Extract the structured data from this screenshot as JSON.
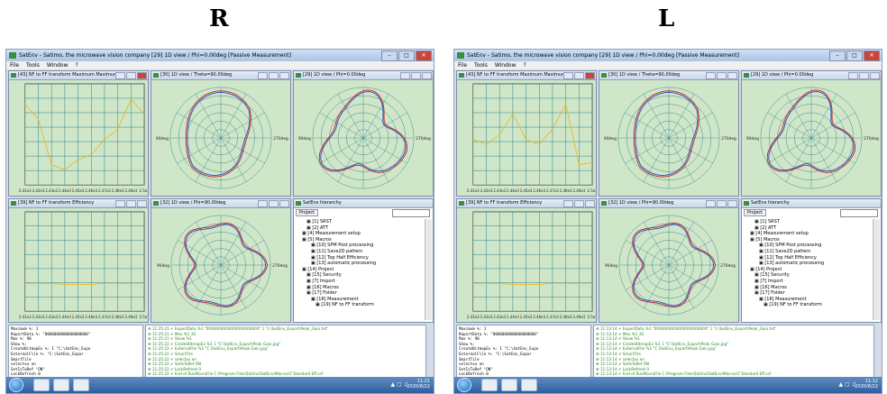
{
  "labels": {
    "left": "R",
    "right": "L"
  },
  "window": {
    "title": "SatEnv - Satimo, the microwave vision company [29] 1D view / Phi=0.00deg [Passive Measurement]",
    "menu": [
      "File",
      "Tools",
      "Window",
      "?"
    ]
  },
  "panes": {
    "tl_title": "[43] NF to FF transform Maximum Maximum",
    "tm_title": "[30] 1D view / Theta=90.00deg",
    "tr_title": "[29] 1D view / Phi=0.00deg",
    "bl_title": "[39] NF to FF transform Efficiency",
    "bm_title": "[32] 1D view / Phi=90.00deg",
    "br_title": "SatEnv hierarchy"
  },
  "polar_labels": {
    "left": "90deg",
    "right": "270deg"
  },
  "xticks": [
    "2.41e3",
    "2.42e3",
    "2.43e3",
    "2.44e3",
    "2.45e3",
    "2.46e3",
    "2.47e3",
    "2.48e3",
    "2.49e3",
    "2.5e3"
  ],
  "tree": {
    "tab": "Project",
    "items": [
      "[1] SRST",
      "[2] ATT",
      "[4] Measurement setup",
      "[5] Macros",
      "[10] SPM Post processing",
      "[11] Save2D pattern",
      "[12] Top Half Efficiency",
      "[13] automatic processing",
      "[14] Project",
      "[15] Security",
      "[7] Import",
      "[16] Macros",
      "[17] Folder",
      "[18] Measurement",
      "[19] NF to FF transform"
    ]
  },
  "console_lines": [
    "Maximum %: 1",
    "ReportData %: \"0000000000000000000\"",
    "Max %: 90",
    "Show %: ",
    "CreateBitmapEx %: 1 \"C:\\SatEnv_Expo",
    "ExternalFile %: \"C:\\SatEnv_Expor",
    "SmartTile",
    "selectxu on",
    "SetIsToRef \"ON\"",
    "LockRefresh 0"
  ],
  "log_lines": [
    "ExportData %1 \"0000000000000000000000\" 1 \"c:\\SatEnv_Export\\Peak_Gain.txt\"",
    "Max %1 30",
    "Show %1",
    "CreateBitmapEx %1 1 \"C:\\SatEnv_Export\\Peak Gain.jpg\"",
    "ExternalFile %1 \"C:\\SatEnv_Export\\Peak Gain.jpg\"",
    "SmartTile",
    "selectxu on",
    "SetIsToRef ON",
    "LockRefresh 0",
    "End of RunMacroFile C:\\Program Files\\Satimo\\SatEnv\\Macros\\Y Standard Eff.scf"
  ],
  "log_times": {
    "right": [
      "11:25:21",
      "11:25:21",
      "11:25:21",
      "11:25:22",
      "11:25:22",
      "11:25:22",
      "11:25:22",
      "11:25:22",
      "11:25:22",
      "11:25:22"
    ],
    "left": [
      "11:13:14",
      "11:13:14",
      "11:13:14",
      "11:13:14",
      "11:13:14",
      "11:13:14",
      "11:13:14",
      "11:13:14",
      "11:13:14",
      "11:13:14"
    ]
  },
  "clock": {
    "right": {
      "time": "11:21",
      "date": "2020/8/22"
    },
    "left": {
      "time": "11:12",
      "date": "2020/8/22"
    }
  },
  "colors": {
    "plot_bg": "#cfe7c8",
    "trace_yellow": "#e8b820",
    "trace_blue": "#2a3fbf",
    "trace_red": "#c02020",
    "grid": "#2a7f8f"
  }
}
